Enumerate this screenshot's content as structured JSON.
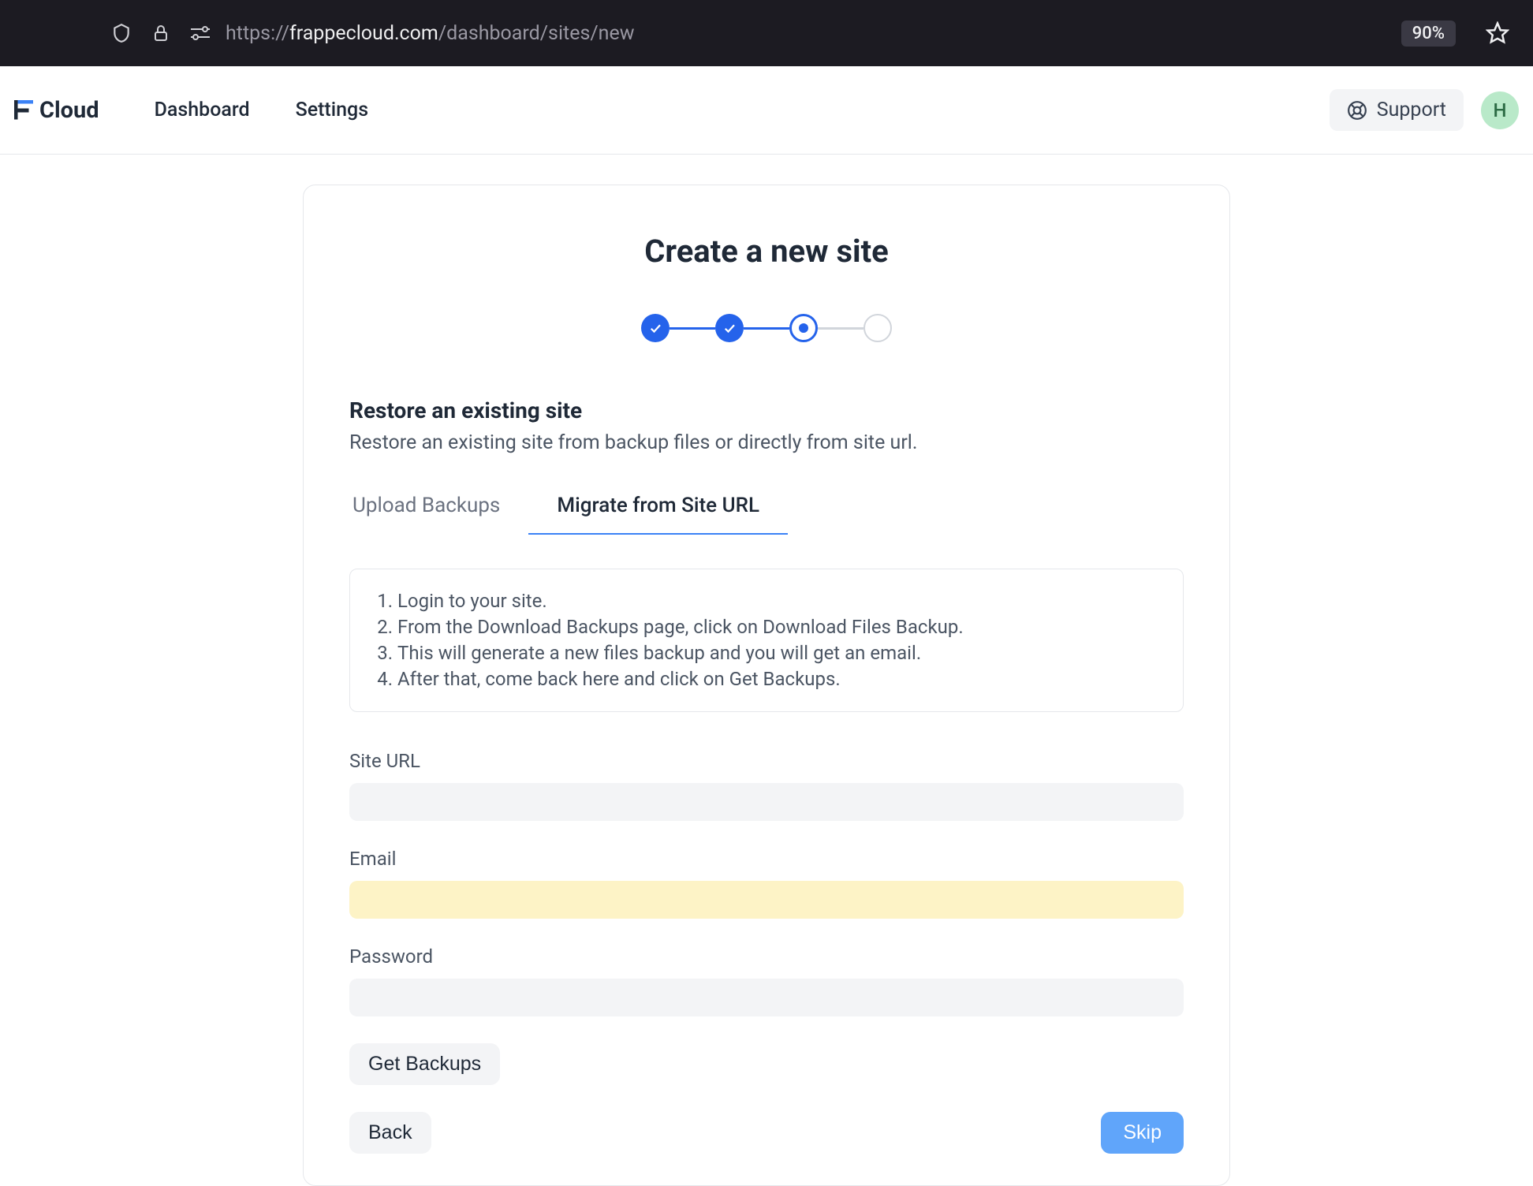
{
  "browser": {
    "url_prefix": "https://",
    "url_host": "frappecloud.com",
    "url_path": "/dashboard/sites/new",
    "zoom": "90%"
  },
  "header": {
    "brand": "Cloud",
    "nav": {
      "dashboard": "Dashboard",
      "settings": "Settings"
    },
    "support": "Support",
    "avatar_initial": "H"
  },
  "card": {
    "title": "Create a new site",
    "section_title": "Restore an existing site",
    "section_sub": "Restore an existing site from backup files or directly from site url.",
    "tabs": {
      "upload": "Upload Backups",
      "migrate": "Migrate from Site URL"
    },
    "instructions": [
      "Login to your site.",
      "From the Download Backups page, click on Download Files Backup.",
      "This will generate a new files backup and you will get an email.",
      "After that, come back here and click on Get Backups."
    ],
    "fields": {
      "site_url_label": "Site URL",
      "site_url_value": "",
      "email_label": "Email",
      "email_value": "",
      "password_label": "Password",
      "password_value": ""
    },
    "buttons": {
      "get_backups": "Get Backups",
      "back": "Back",
      "skip": "Skip"
    }
  }
}
